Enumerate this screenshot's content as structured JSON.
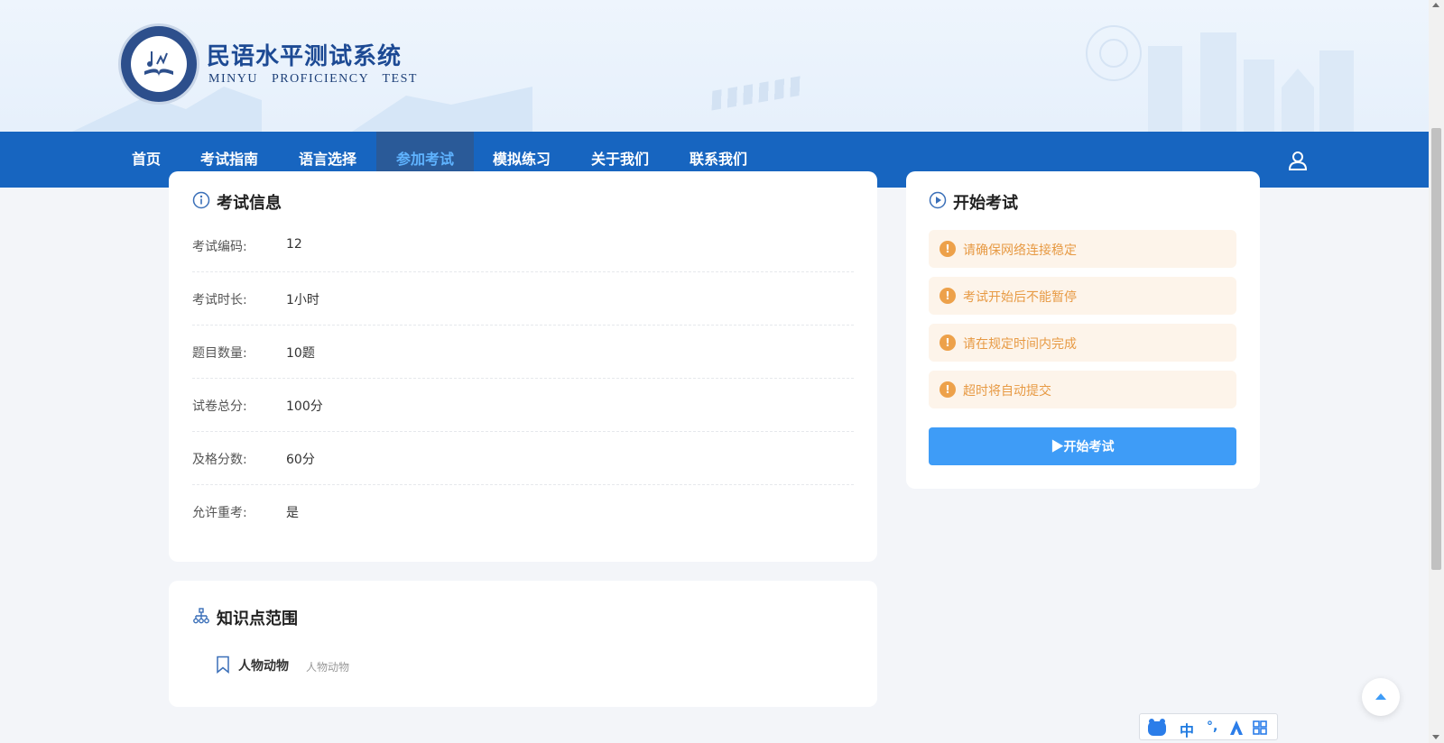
{
  "brand": {
    "title": "民语水平测试系统",
    "subtitle": "MINYU PROFICIENCY TEST"
  },
  "nav": {
    "items": [
      {
        "label": "首页"
      },
      {
        "label": "考试指南"
      },
      {
        "label": "语言选择"
      },
      {
        "label": "参加考试",
        "active": true
      },
      {
        "label": "模拟练习"
      },
      {
        "label": "关于我们"
      },
      {
        "label": "联系我们"
      }
    ],
    "user_icon": "user-icon"
  },
  "exam_info": {
    "title": "考试信息",
    "rows": [
      {
        "label": "考试编码:",
        "value": "12"
      },
      {
        "label": "考试时长:",
        "value": "1小时"
      },
      {
        "label": "题目数量:",
        "value": "10题"
      },
      {
        "label": "试卷总分:",
        "value": "100分"
      },
      {
        "label": "及格分数:",
        "value": "60分"
      },
      {
        "label": "允许重考:",
        "value": "是"
      }
    ]
  },
  "knowledge": {
    "title": "知识点范围",
    "items": [
      {
        "name": "人物动物",
        "desc": "人物动物"
      }
    ]
  },
  "start": {
    "title": "开始考试",
    "notices": [
      "请确保网络连接稳定",
      "考试开始后不能暂停",
      "请在规定时间内完成",
      "超时将自动提交"
    ],
    "button_label": "开始考试"
  },
  "ime": {
    "zh": "中",
    "punct": "°,"
  },
  "colors": {
    "nav_bg": "#1765c0",
    "nav_active_bg": "#2a5a98",
    "nav_active_text": "#5fb3ff",
    "primary_button": "#3e9cf7",
    "notice_bg": "#fdf4ea",
    "notice_text": "#e79a44",
    "brand_text": "#1d4a94"
  }
}
